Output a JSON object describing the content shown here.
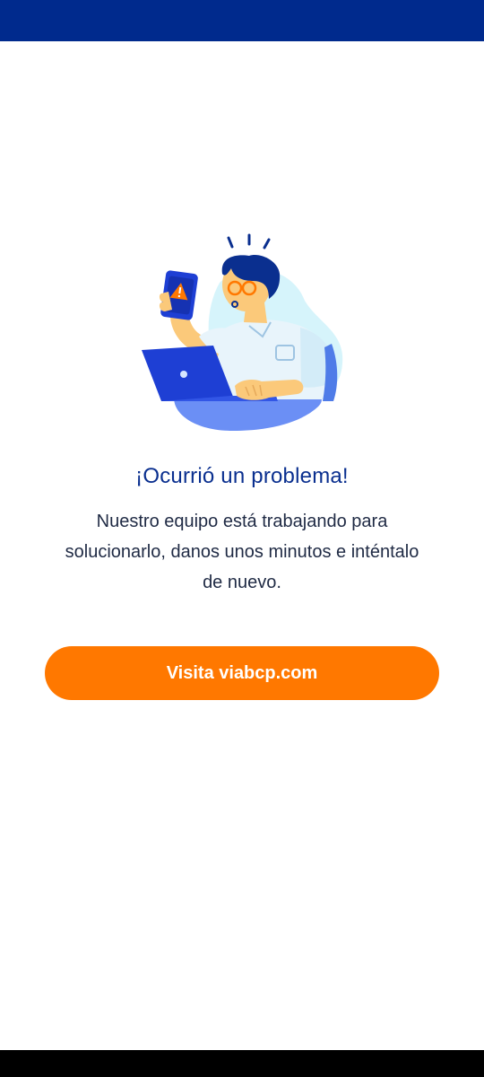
{
  "screen": {
    "title": "¡Ocurrió un problema!",
    "message": "Nuestro equipo está trabajando para solucionarlo, danos unos minutos e inténtalo de nuevo.",
    "button_label": "Visita viabcp.com"
  },
  "illustration": {
    "icon": "person-with-phone-warning-and-laptop",
    "warning_icon": "warning-triangle-icon"
  },
  "colors": {
    "status_bar": "#002a8d",
    "title": "#0a2f8f",
    "text": "#1f2a44",
    "button": "#ff7800",
    "button_text": "#ffffff",
    "nav_bar": "#000000"
  }
}
